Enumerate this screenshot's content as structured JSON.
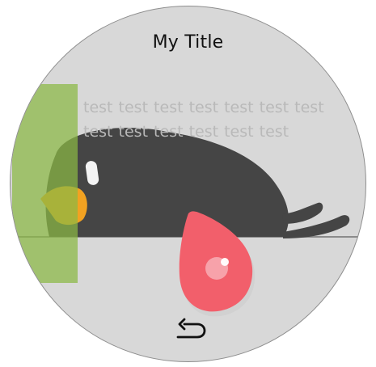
{
  "title": "My Title",
  "sample_text": "test test test test test test test test test test test test test",
  "icons": {
    "back": "back-arrow-icon",
    "illustration": "penguin-icon",
    "drop": "water-drop-icon"
  },
  "colors": {
    "background": "#d8d8d8",
    "green_overlay": "#8bb844",
    "penguin": "#454545",
    "beak": "#f2a221",
    "drop": "#f25f6b"
  }
}
